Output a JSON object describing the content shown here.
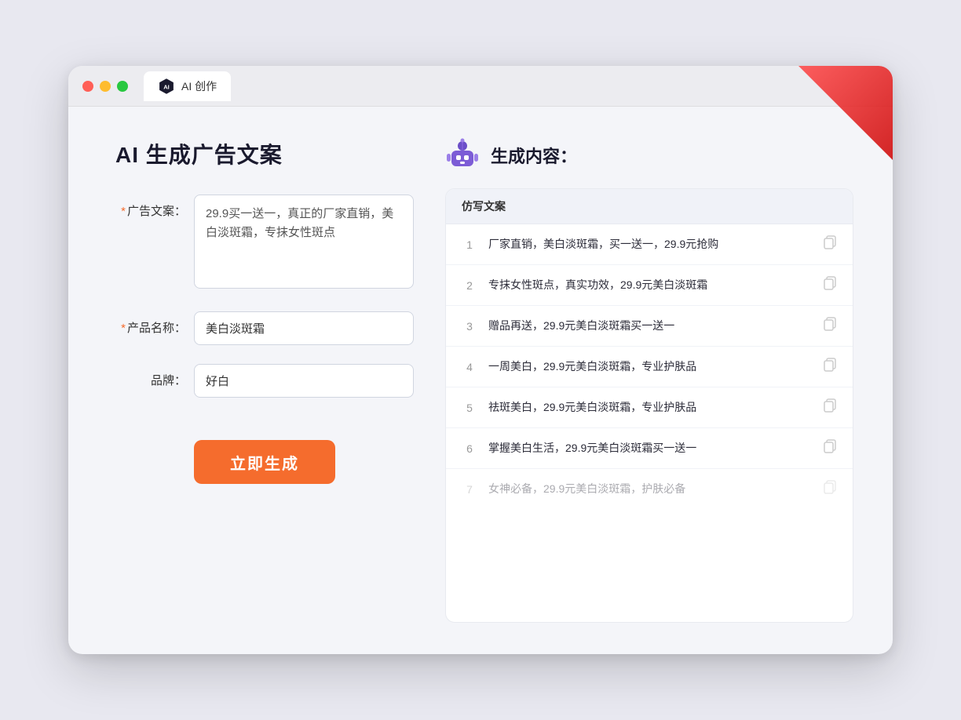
{
  "browser": {
    "tab_title": "AI 创作",
    "traffic_lights": [
      "red",
      "yellow",
      "green"
    ]
  },
  "left_panel": {
    "main_title": "AI 生成广告文案",
    "form": {
      "ad_copy_label": "广告文案：",
      "ad_copy_required": "*",
      "ad_copy_value": "29.9买一送一，真正的厂家直销，美白淡斑霜，专抹女性斑点",
      "product_name_label": "产品名称：",
      "product_name_required": "*",
      "product_name_value": "美白淡斑霜",
      "brand_label": "品牌：",
      "brand_value": "好白"
    },
    "generate_button": "立即生成"
  },
  "right_panel": {
    "title": "生成内容：",
    "results_header": "仿写文案",
    "results": [
      {
        "num": "1",
        "text": "厂家直销，美白淡斑霜，买一送一，29.9元抢购",
        "faded": false
      },
      {
        "num": "2",
        "text": "专抹女性斑点，真实功效，29.9元美白淡斑霜",
        "faded": false
      },
      {
        "num": "3",
        "text": "赠品再送，29.9元美白淡斑霜买一送一",
        "faded": false
      },
      {
        "num": "4",
        "text": "一周美白，29.9元美白淡斑霜，专业护肤品",
        "faded": false
      },
      {
        "num": "5",
        "text": "祛斑美白，29.9元美白淡斑霜，专业护肤品",
        "faded": false
      },
      {
        "num": "6",
        "text": "掌握美白生活，29.9元美白淡斑霜买一送一",
        "faded": false
      },
      {
        "num": "7",
        "text": "女神必备，29.9元美白淡斑霜，护肤必备",
        "faded": true
      }
    ]
  },
  "icons": {
    "robot": "🤖",
    "copy": "📋",
    "ai_badge": "AI"
  }
}
